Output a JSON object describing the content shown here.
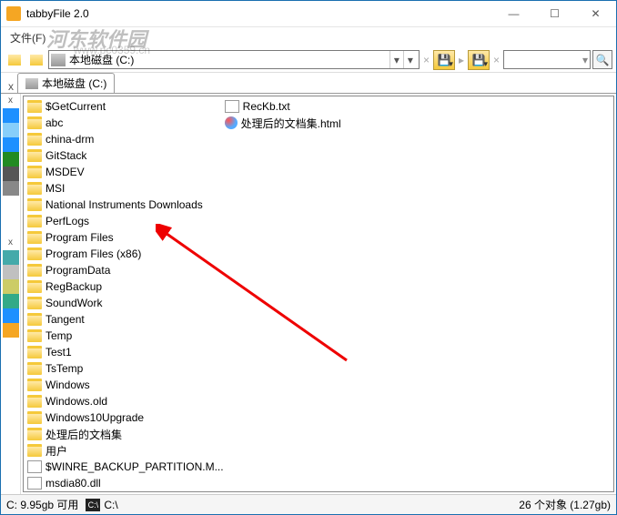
{
  "title": "tabbyFile 2.0",
  "watermark": "河东软件园",
  "watermark_url": "www.pc0359.cn",
  "menubar": {
    "file": "文件(F)"
  },
  "path": {
    "label": "本地磁盘 (C:)"
  },
  "tab": {
    "label": "本地磁盘 (C:)"
  },
  "files": {
    "col1": [
      {
        "name": "$GetCurrent",
        "type": "folder"
      },
      {
        "name": "abc",
        "type": "folder"
      },
      {
        "name": "china-drm",
        "type": "folder"
      },
      {
        "name": "GitStack",
        "type": "folder"
      },
      {
        "name": "MSDEV",
        "type": "folder"
      },
      {
        "name": "MSI",
        "type": "folder"
      },
      {
        "name": "National Instruments Downloads",
        "type": "folder"
      },
      {
        "name": "PerfLogs",
        "type": "folder"
      },
      {
        "name": "Program Files",
        "type": "folder"
      },
      {
        "name": "Program Files (x86)",
        "type": "folder"
      },
      {
        "name": "ProgramData",
        "type": "folder"
      },
      {
        "name": "RegBackup",
        "type": "folder"
      },
      {
        "name": "SoundWork",
        "type": "folder"
      },
      {
        "name": "Tangent",
        "type": "folder"
      },
      {
        "name": "Temp",
        "type": "folder"
      },
      {
        "name": "Test1",
        "type": "folder"
      },
      {
        "name": "TsTemp",
        "type": "folder"
      },
      {
        "name": "Windows",
        "type": "folder"
      },
      {
        "name": "Windows.old",
        "type": "folder"
      },
      {
        "name": "Windows10Upgrade",
        "type": "folder"
      },
      {
        "name": "处理后的文档集",
        "type": "folder"
      },
      {
        "name": "用户",
        "type": "folder"
      },
      {
        "name": "$WINRE_BACKUP_PARTITION.M...",
        "type": "file"
      },
      {
        "name": "msdia80.dll",
        "type": "file"
      },
      {
        "name": "RecKb.txt",
        "type": "file"
      }
    ],
    "col2": [
      {
        "name": "处理后的文档集.html",
        "type": "html"
      }
    ]
  },
  "status": {
    "free": "C: 9.95gb 可用",
    "prompt": "C:\\",
    "objects": "26 个对象 (1.27gb)"
  },
  "icons": {
    "min": "—",
    "max": "☐",
    "close": "✕",
    "down": "▾",
    "search": "🔍",
    "x": "x",
    "sep": "×",
    "back": "◀",
    "fwd": "▶",
    "right": "▸"
  },
  "sidebar_colors": [
    "#1e90ff",
    "#87cefa",
    "#1e90ff",
    "#228b22",
    "#555",
    "#888"
  ],
  "sidebar2_colors": [
    "#4aa",
    "#c0c0c0",
    "#cc6",
    "#3a8",
    "#1e90ff",
    "#f5a623"
  ]
}
